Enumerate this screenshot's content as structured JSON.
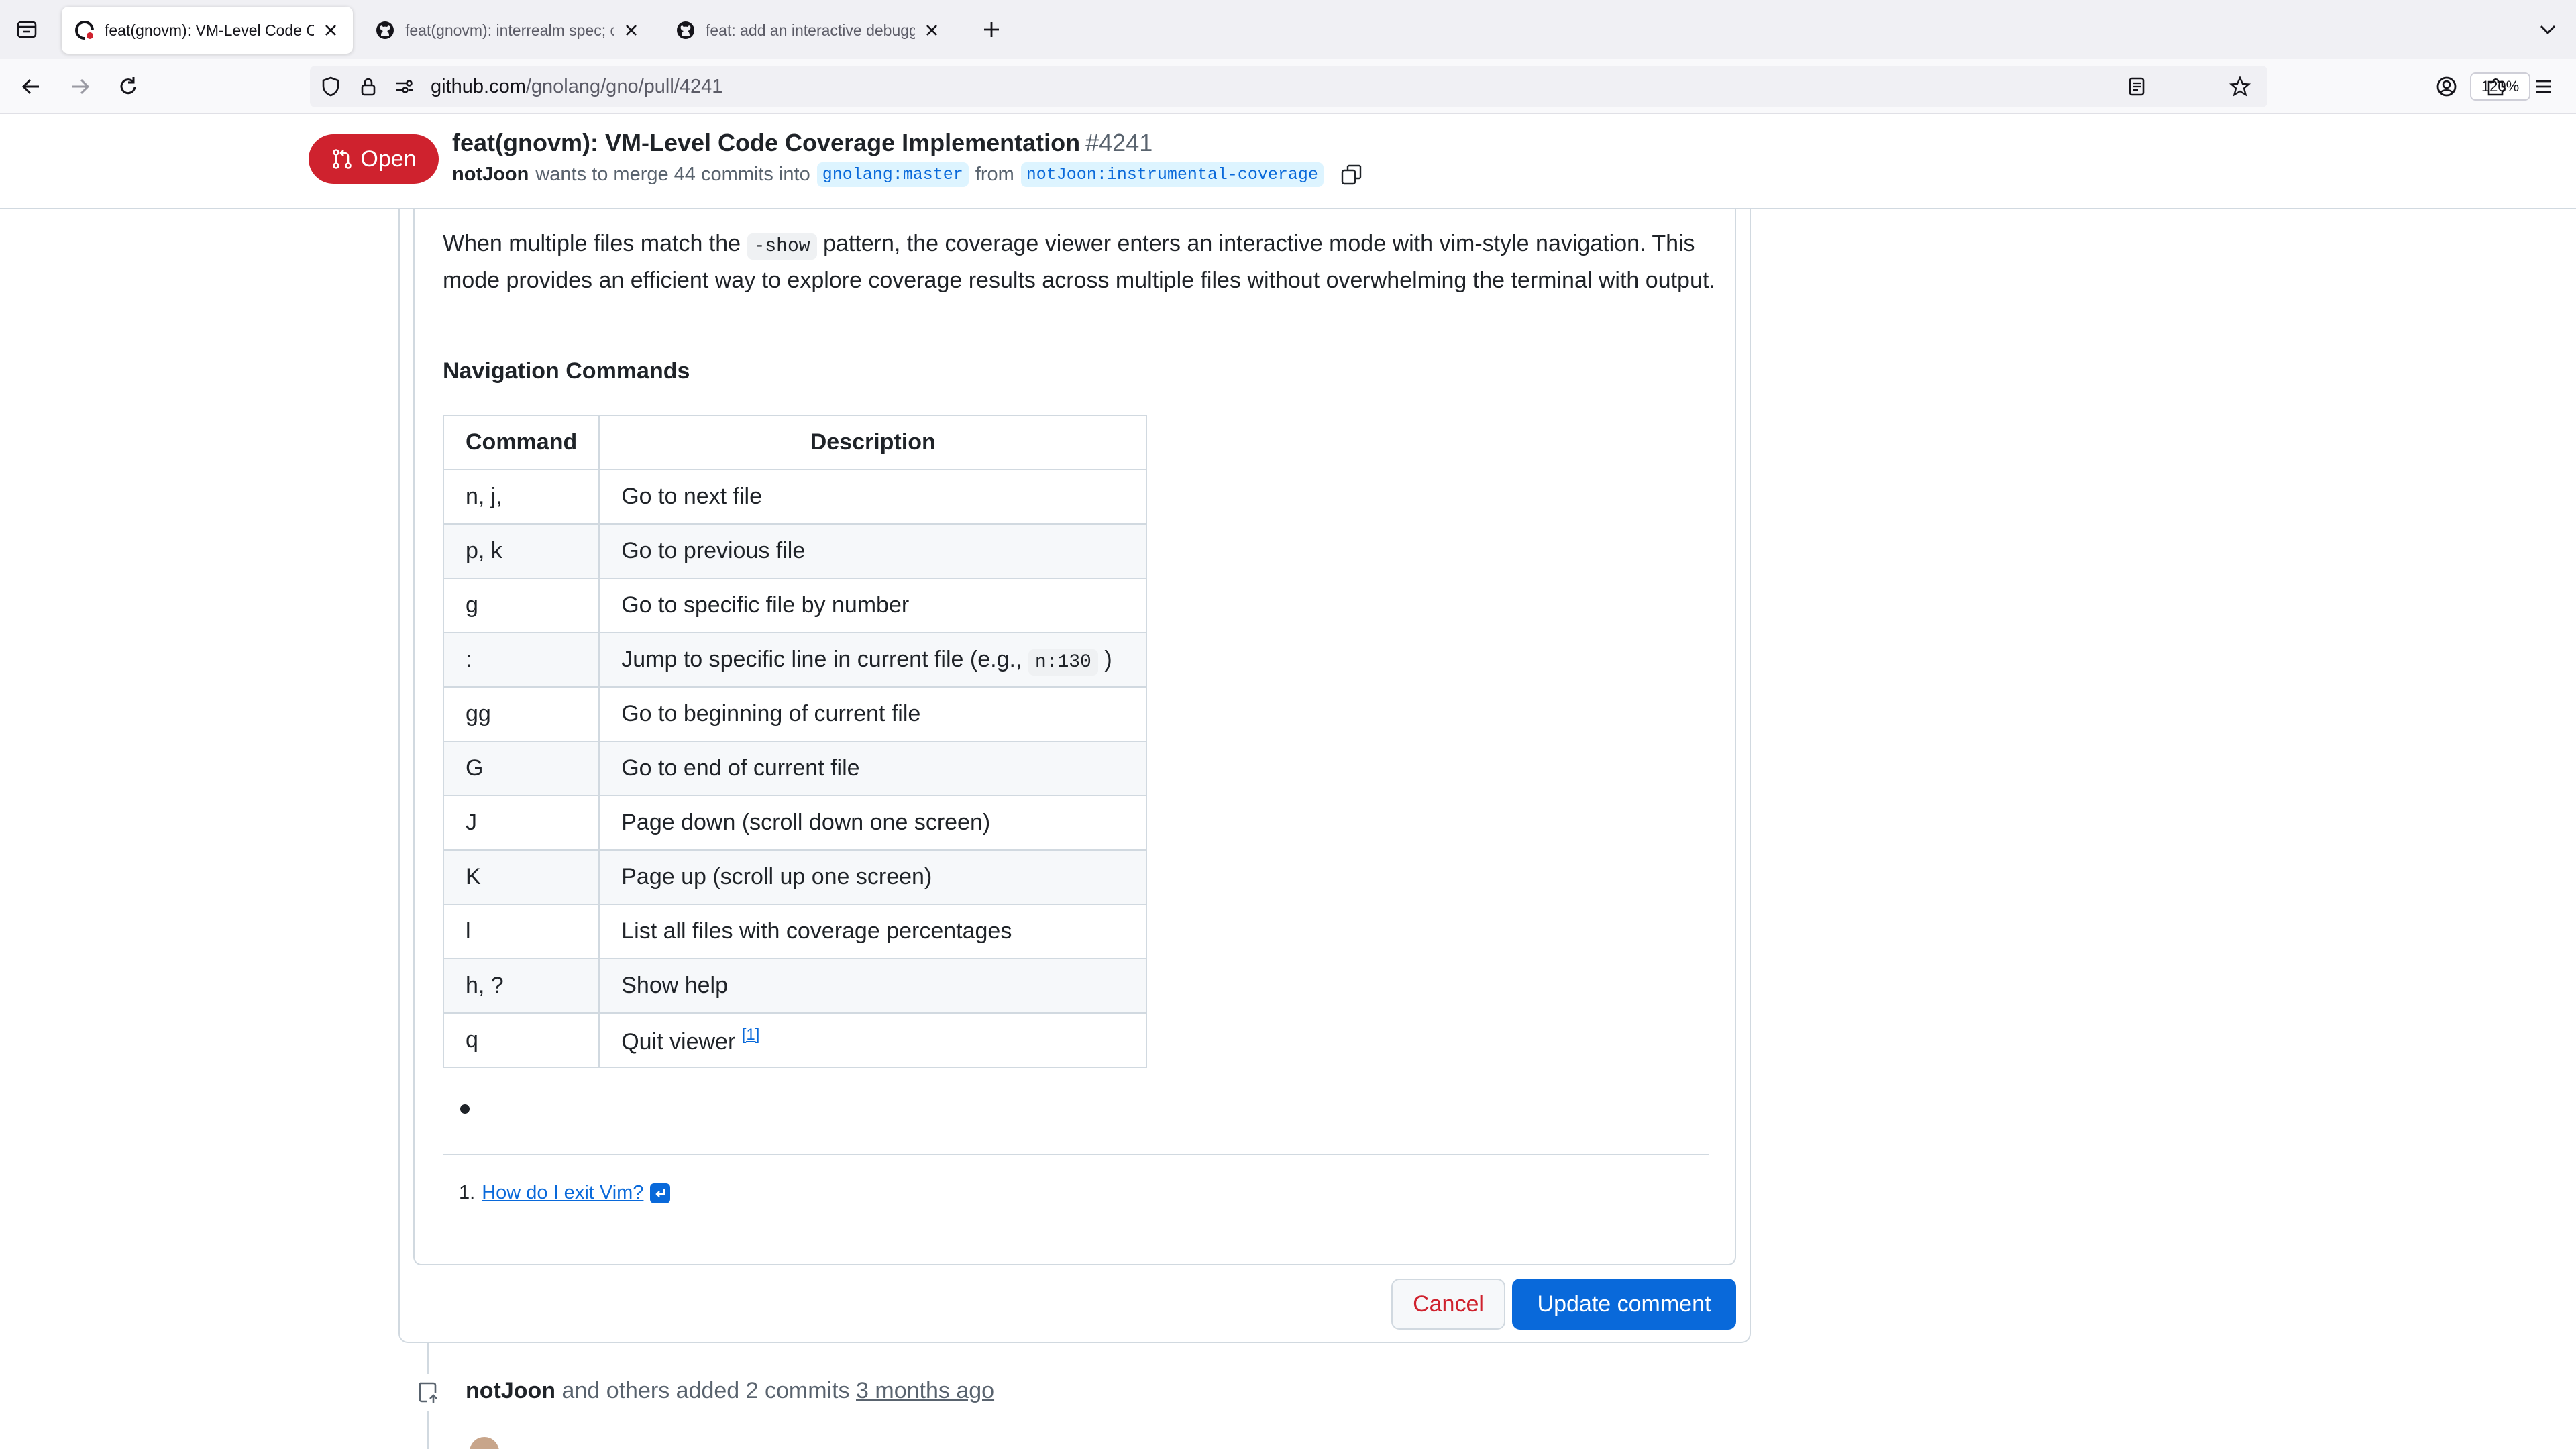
{
  "browser": {
    "tabs": [
      {
        "title": "feat(gnovm): VM-Level Code Coverage Implementation",
        "active": true
      },
      {
        "title": "feat(gnovm): interrealm spec; c...",
        "active": false
      },
      {
        "title": "feat: add an interactive debugger",
        "active": false
      }
    ],
    "url": {
      "host": "github.com",
      "path": "/gnolang/gno/pull/4241"
    },
    "zoom": "120%"
  },
  "pr": {
    "state": "Open",
    "title": "feat(gnovm): VM-Level Code Coverage Implementation",
    "number": "#4241",
    "author": "notJoon",
    "merge_text": "wants to merge 44 commits into",
    "base_branch": "gnolang:master",
    "from_text": "from",
    "head_branch": "notJoon:instrumental-coverage"
  },
  "comment": {
    "para_before": "When multiple files match the",
    "para_code": "-show",
    "para_after": "pattern, the coverage viewer enters an interactive mode with vim-style navigation. This mode provides an efficient way to explore coverage results across multiple files without overwhelming the terminal with output.",
    "heading": "Navigation Commands",
    "table": {
      "headers": [
        "Command",
        "Description"
      ],
      "rows": [
        {
          "cmd": "n, j,",
          "desc": "Go to next file"
        },
        {
          "cmd": "p, k",
          "desc": "Go to previous file"
        },
        {
          "cmd": "g",
          "desc": "Go to specific file by number"
        },
        {
          "cmd": ":",
          "desc": "Jump to specific line in current file (e.g.,",
          "code": "n:130",
          "desc_after": ")"
        },
        {
          "cmd": "gg",
          "desc": "Go to beginning of current file"
        },
        {
          "cmd": "G",
          "desc": "Go to end of current file"
        },
        {
          "cmd": "J",
          "desc": "Page down (scroll down one screen)"
        },
        {
          "cmd": "K",
          "desc": "Page up (scroll up one screen)"
        },
        {
          "cmd": "l",
          "desc": "List all files with coverage percentages"
        },
        {
          "cmd": "h, ?",
          "desc": "Show help"
        },
        {
          "cmd": "q",
          "desc": "Quit viewer",
          "footnote": "[1]"
        }
      ]
    },
    "footnote_number": "1.",
    "footnote_link": "How do I exit Vim?"
  },
  "actions": {
    "cancel": "Cancel",
    "update": "Update comment"
  },
  "timeline": {
    "author": "notJoon",
    "text": "and others added 2 commits",
    "time": "3 months ago"
  },
  "colors": {
    "open": "#cf222e",
    "primary": "#0969da",
    "border": "#d1d9e0"
  }
}
